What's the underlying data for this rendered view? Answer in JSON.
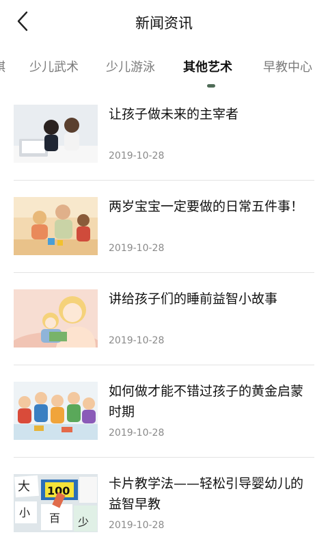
{
  "header": {
    "title": "新闻资讯"
  },
  "tabs": [
    {
      "label": "棋"
    },
    {
      "label": "少儿武术"
    },
    {
      "label": "少儿游泳"
    },
    {
      "label": "其他艺术"
    },
    {
      "label": "早教中心"
    }
  ],
  "active_tab": "其他艺术",
  "articles": [
    {
      "title": "让孩子做未来的主宰者",
      "date": "2019-10-28"
    },
    {
      "title": "两岁宝宝一定要做的日常五件事！",
      "date": "2019-10-28"
    },
    {
      "title": "讲给孩子们的睡前益智小故事",
      "date": "2019-10-28"
    },
    {
      "title": "如何做才能不错过孩子的黄金启蒙时期",
      "date": "2019-10-28"
    },
    {
      "title": "卡片教学法——轻松引导婴幼儿的益智早教",
      "date": "2019-10-28"
    }
  ],
  "card_text": {
    "c1": "大",
    "c2": "100",
    "c3": "小",
    "c4": "百",
    "c5": "少"
  },
  "colors": {
    "accent": "#4f6b57"
  }
}
